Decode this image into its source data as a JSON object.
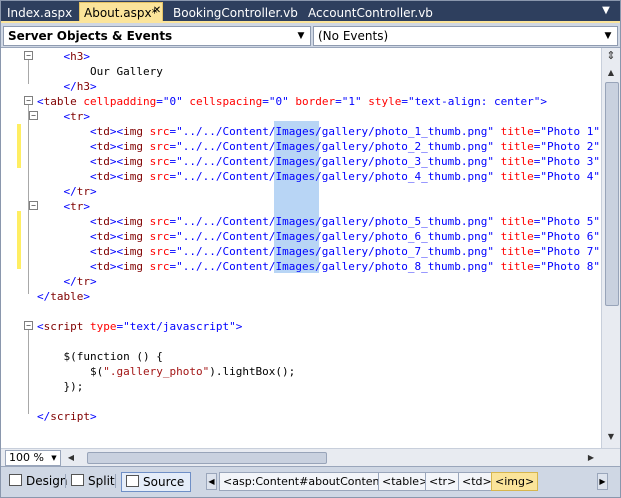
{
  "tabs": [
    {
      "label": "Index.aspx",
      "active": false
    },
    {
      "label": "About.aspx*",
      "active": true
    },
    {
      "label": "BookingController.vb",
      "active": false
    },
    {
      "label": "AccountController.vb",
      "active": false
    }
  ],
  "navigation": {
    "objects_combo": "Server Objects & Events",
    "events_combo": "(No Events)"
  },
  "code_lines": [
    [
      {
        "t": "    ",
        "c": "text"
      },
      {
        "t": "<",
        "c": "delim"
      },
      {
        "t": "h3",
        "c": "tag"
      },
      {
        "t": ">",
        "c": "delim"
      }
    ],
    [
      {
        "t": "        Our Gallery",
        "c": "text"
      }
    ],
    [
      {
        "t": "    ",
        "c": "text"
      },
      {
        "t": "</",
        "c": "delim"
      },
      {
        "t": "h3",
        "c": "tag"
      },
      {
        "t": ">",
        "c": "delim"
      }
    ],
    [
      {
        "t": "<",
        "c": "delim"
      },
      {
        "t": "table",
        "c": "tag"
      },
      {
        "t": " cellpadding",
        "c": "attr"
      },
      {
        "t": "=",
        "c": "delim"
      },
      {
        "t": "\"0\"",
        "c": "val"
      },
      {
        "t": " cellspacing",
        "c": "attr"
      },
      {
        "t": "=",
        "c": "delim"
      },
      {
        "t": "\"0\"",
        "c": "val"
      },
      {
        "t": " border",
        "c": "attr"
      },
      {
        "t": "=",
        "c": "delim"
      },
      {
        "t": "\"1\"",
        "c": "val"
      },
      {
        "t": " style",
        "c": "attr"
      },
      {
        "t": "=",
        "c": "delim"
      },
      {
        "t": "\"text-align: center\"",
        "c": "val"
      },
      {
        "t": ">",
        "c": "delim"
      }
    ],
    [
      {
        "t": "    ",
        "c": "text"
      },
      {
        "t": "<",
        "c": "delim"
      },
      {
        "t": "tr",
        "c": "tag"
      },
      {
        "t": ">",
        "c": "delim"
      }
    ],
    [
      {
        "t": "        ",
        "c": "text"
      },
      {
        "t": "<",
        "c": "delim"
      },
      {
        "t": "td",
        "c": "tag"
      },
      {
        "t": "><",
        "c": "delim"
      },
      {
        "t": "img",
        "c": "tag"
      },
      {
        "t": " src",
        "c": "attr"
      },
      {
        "t": "=",
        "c": "delim"
      },
      {
        "t": "\"../../Content/Images/gallery/photo_1_thumb.png\"",
        "c": "val"
      },
      {
        "t": " title",
        "c": "attr"
      },
      {
        "t": "=",
        "c": "delim"
      },
      {
        "t": "\"Photo 1\"",
        "c": "val"
      }
    ],
    [
      {
        "t": "        ",
        "c": "text"
      },
      {
        "t": "<",
        "c": "delim"
      },
      {
        "t": "td",
        "c": "tag"
      },
      {
        "t": "><",
        "c": "delim"
      },
      {
        "t": "img",
        "c": "tag"
      },
      {
        "t": " src",
        "c": "attr"
      },
      {
        "t": "=",
        "c": "delim"
      },
      {
        "t": "\"../../Content/Images/gallery/photo_2_thumb.png\"",
        "c": "val"
      },
      {
        "t": " title",
        "c": "attr"
      },
      {
        "t": "=",
        "c": "delim"
      },
      {
        "t": "\"Photo 2\"",
        "c": "val"
      }
    ],
    [
      {
        "t": "        ",
        "c": "text"
      },
      {
        "t": "<",
        "c": "delim"
      },
      {
        "t": "td",
        "c": "tag"
      },
      {
        "t": "><",
        "c": "delim"
      },
      {
        "t": "img",
        "c": "tag"
      },
      {
        "t": " src",
        "c": "attr"
      },
      {
        "t": "=",
        "c": "delim"
      },
      {
        "t": "\"../../Content/Images/gallery/photo_3_thumb.png\"",
        "c": "val"
      },
      {
        "t": " title",
        "c": "attr"
      },
      {
        "t": "=",
        "c": "delim"
      },
      {
        "t": "\"Photo 3\"",
        "c": "val"
      }
    ],
    [
      {
        "t": "        ",
        "c": "text"
      },
      {
        "t": "<",
        "c": "delim"
      },
      {
        "t": "td",
        "c": "tag"
      },
      {
        "t": "><",
        "c": "delim"
      },
      {
        "t": "img",
        "c": "tag"
      },
      {
        "t": " src",
        "c": "attr"
      },
      {
        "t": "=",
        "c": "delim"
      },
      {
        "t": "\"../../Content/Images/gallery/photo_4_thumb.png\"",
        "c": "val"
      },
      {
        "t": " title",
        "c": "attr"
      },
      {
        "t": "=",
        "c": "delim"
      },
      {
        "t": "\"Photo 4\"",
        "c": "val"
      }
    ],
    [
      {
        "t": "    ",
        "c": "text"
      },
      {
        "t": "</",
        "c": "delim"
      },
      {
        "t": "tr",
        "c": "tag"
      },
      {
        "t": ">",
        "c": "delim"
      }
    ],
    [
      {
        "t": "    ",
        "c": "text"
      },
      {
        "t": "<",
        "c": "delim"
      },
      {
        "t": "tr",
        "c": "tag"
      },
      {
        "t": ">",
        "c": "delim"
      }
    ],
    [
      {
        "t": "        ",
        "c": "text"
      },
      {
        "t": "<",
        "c": "delim"
      },
      {
        "t": "td",
        "c": "tag"
      },
      {
        "t": "><",
        "c": "delim"
      },
      {
        "t": "img",
        "c": "tag"
      },
      {
        "t": " src",
        "c": "attr"
      },
      {
        "t": "=",
        "c": "delim"
      },
      {
        "t": "\"../../Content/Images/gallery/photo_5_thumb.png\"",
        "c": "val"
      },
      {
        "t": " title",
        "c": "attr"
      },
      {
        "t": "=",
        "c": "delim"
      },
      {
        "t": "\"Photo 5\"",
        "c": "val"
      }
    ],
    [
      {
        "t": "        ",
        "c": "text"
      },
      {
        "t": "<",
        "c": "delim"
      },
      {
        "t": "td",
        "c": "tag"
      },
      {
        "t": "><",
        "c": "delim"
      },
      {
        "t": "img",
        "c": "tag"
      },
      {
        "t": " src",
        "c": "attr"
      },
      {
        "t": "=",
        "c": "delim"
      },
      {
        "t": "\"../../Content/Images/gallery/photo_6_thumb.png\"",
        "c": "val"
      },
      {
        "t": " title",
        "c": "attr"
      },
      {
        "t": "=",
        "c": "delim"
      },
      {
        "t": "\"Photo 6\"",
        "c": "val"
      }
    ],
    [
      {
        "t": "        ",
        "c": "text"
      },
      {
        "t": "<",
        "c": "delim"
      },
      {
        "t": "td",
        "c": "tag"
      },
      {
        "t": "><",
        "c": "delim"
      },
      {
        "t": "img",
        "c": "tag"
      },
      {
        "t": " src",
        "c": "attr"
      },
      {
        "t": "=",
        "c": "delim"
      },
      {
        "t": "\"../../Content/Images/gallery/photo_7_thumb.png\"",
        "c": "val"
      },
      {
        "t": " title",
        "c": "attr"
      },
      {
        "t": "=",
        "c": "delim"
      },
      {
        "t": "\"Photo 7\"",
        "c": "val"
      }
    ],
    [
      {
        "t": "        ",
        "c": "text"
      },
      {
        "t": "<",
        "c": "delim"
      },
      {
        "t": "td",
        "c": "tag"
      },
      {
        "t": "><",
        "c": "delim"
      },
      {
        "t": "img",
        "c": "tag"
      },
      {
        "t": " src",
        "c": "attr"
      },
      {
        "t": "=",
        "c": "delim"
      },
      {
        "t": "\"../../Content/Images/gallery/photo_8_thumb.png\"",
        "c": "val"
      },
      {
        "t": " title",
        "c": "attr"
      },
      {
        "t": "=",
        "c": "delim"
      },
      {
        "t": "\"Photo 8\"",
        "c": "val"
      }
    ],
    [
      {
        "t": "    ",
        "c": "text"
      },
      {
        "t": "</",
        "c": "delim"
      },
      {
        "t": "tr",
        "c": "tag"
      },
      {
        "t": ">",
        "c": "delim"
      }
    ],
    [
      {
        "t": "</",
        "c": "delim"
      },
      {
        "t": "table",
        "c": "tag"
      },
      {
        "t": ">",
        "c": "delim"
      }
    ],
    [],
    [
      {
        "t": "<",
        "c": "delim"
      },
      {
        "t": "script",
        "c": "tag"
      },
      {
        "t": " type",
        "c": "attr"
      },
      {
        "t": "=",
        "c": "delim"
      },
      {
        "t": "\"text/javascript\"",
        "c": "val"
      },
      {
        "t": ">",
        "c": "delim"
      }
    ],
    [],
    [
      {
        "t": "    $(function () {",
        "c": "js"
      }
    ],
    [
      {
        "t": "        $(",
        "c": "js"
      },
      {
        "t": "\".gallery_photo\"",
        "c": "str"
      },
      {
        "t": ").lightBox();",
        "c": "js"
      }
    ],
    [
      {
        "t": "    });",
        "c": "js"
      }
    ],
    [],
    [
      {
        "t": "</",
        "c": "delim"
      },
      {
        "t": "script",
        "c": "tag"
      },
      {
        "t": ">",
        "c": "delim"
      }
    ]
  ],
  "statusbar": {
    "zoom": "100 %"
  },
  "views": {
    "design": "Design",
    "split": "Split",
    "source": "Source"
  },
  "breadcrumbs": [
    "<asp:Content#aboutContent>",
    "<table>",
    "<tr>",
    "<td>",
    "<img>"
  ],
  "colors": {
    "tabstrip_bg": "#2e3f5e",
    "active_tab": "#fbe49a",
    "tag": "#800000",
    "attribute": "#ff0000",
    "value": "#0000ff",
    "selection": "#b8d5f5",
    "change_marker": "#ffee62"
  }
}
